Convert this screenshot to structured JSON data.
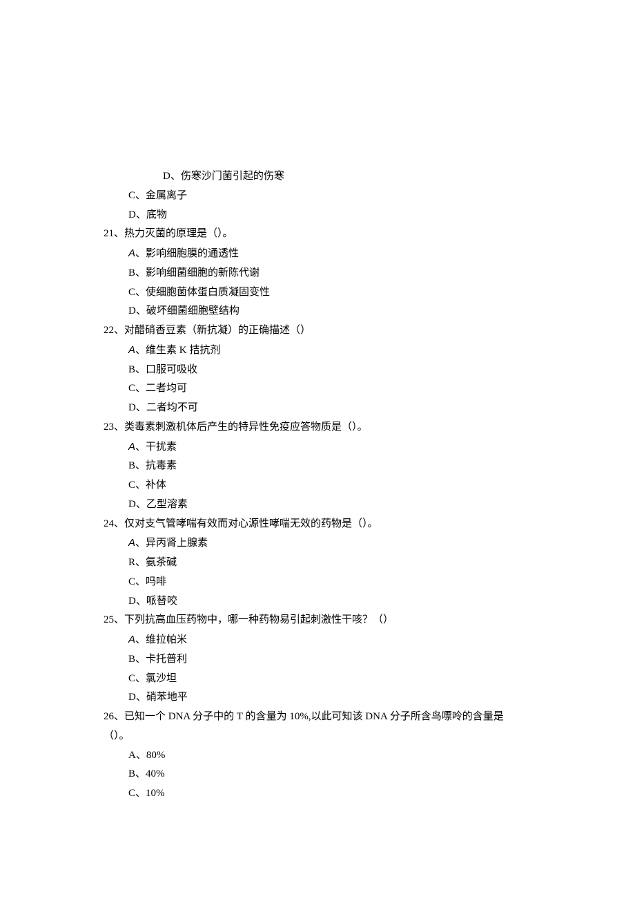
{
  "orphan": {
    "d": "D、伤寒沙门菌引起的伤寒",
    "c": "C、金属离子",
    "d2": "D、底物"
  },
  "q21": {
    "stem": "21、热力灭菌的原理是（）。",
    "a_mark": "A",
    "a_text": "、影响细胞膜的通透性",
    "b": "B、影响细菌细胞的新陈代谢",
    "c": "C、使细胞菌体蛋白质凝固变性",
    "d": "D、破坏细菌细胞壁结构"
  },
  "q22": {
    "stem": "22、对醋硝香豆素（新抗凝）的正确描述（）",
    "a_mark": "A",
    "a_text": "、维生素 K 拮抗剂",
    "b": "B、口服可吸收",
    "c": "C、二者均可",
    "d": "D、二者均不可"
  },
  "q23": {
    "stem": "23、类毒素刺激机体后产生的特异性免疫应答物质是（）。",
    "a_mark": "A",
    "a_text": "、干扰素",
    "b": "B、抗毒素",
    "c": "C、补体",
    "d": "D、乙型溶素"
  },
  "q24": {
    "stem": "24、仅对支气管哮喘有效而对心源性哮喘无效的药物是（）。",
    "a_mark": "A",
    "a_text": "、异丙肾上腺素",
    "b": "R、氨茶碱",
    "c": "C、吗啡",
    "d": "D、哌替咬"
  },
  "q25": {
    "stem": "25、下列抗高血压药物中，哪一种药物易引起刺激性干咳？（）",
    "a_mark": "A",
    "a_text": "、维拉帕米",
    "b": "B、卡托普利",
    "c": "C、氯沙坦",
    "d": "D、硝苯地平"
  },
  "q26": {
    "stem": "26、已知一个 DNA 分子中的 T 的含量为 10%,以此可知该 DNA 分子所含鸟嘌呤的含量是",
    "stem2": "（）。",
    "a": "A、80%",
    "b": "B、40%",
    "c": "C、10%"
  }
}
